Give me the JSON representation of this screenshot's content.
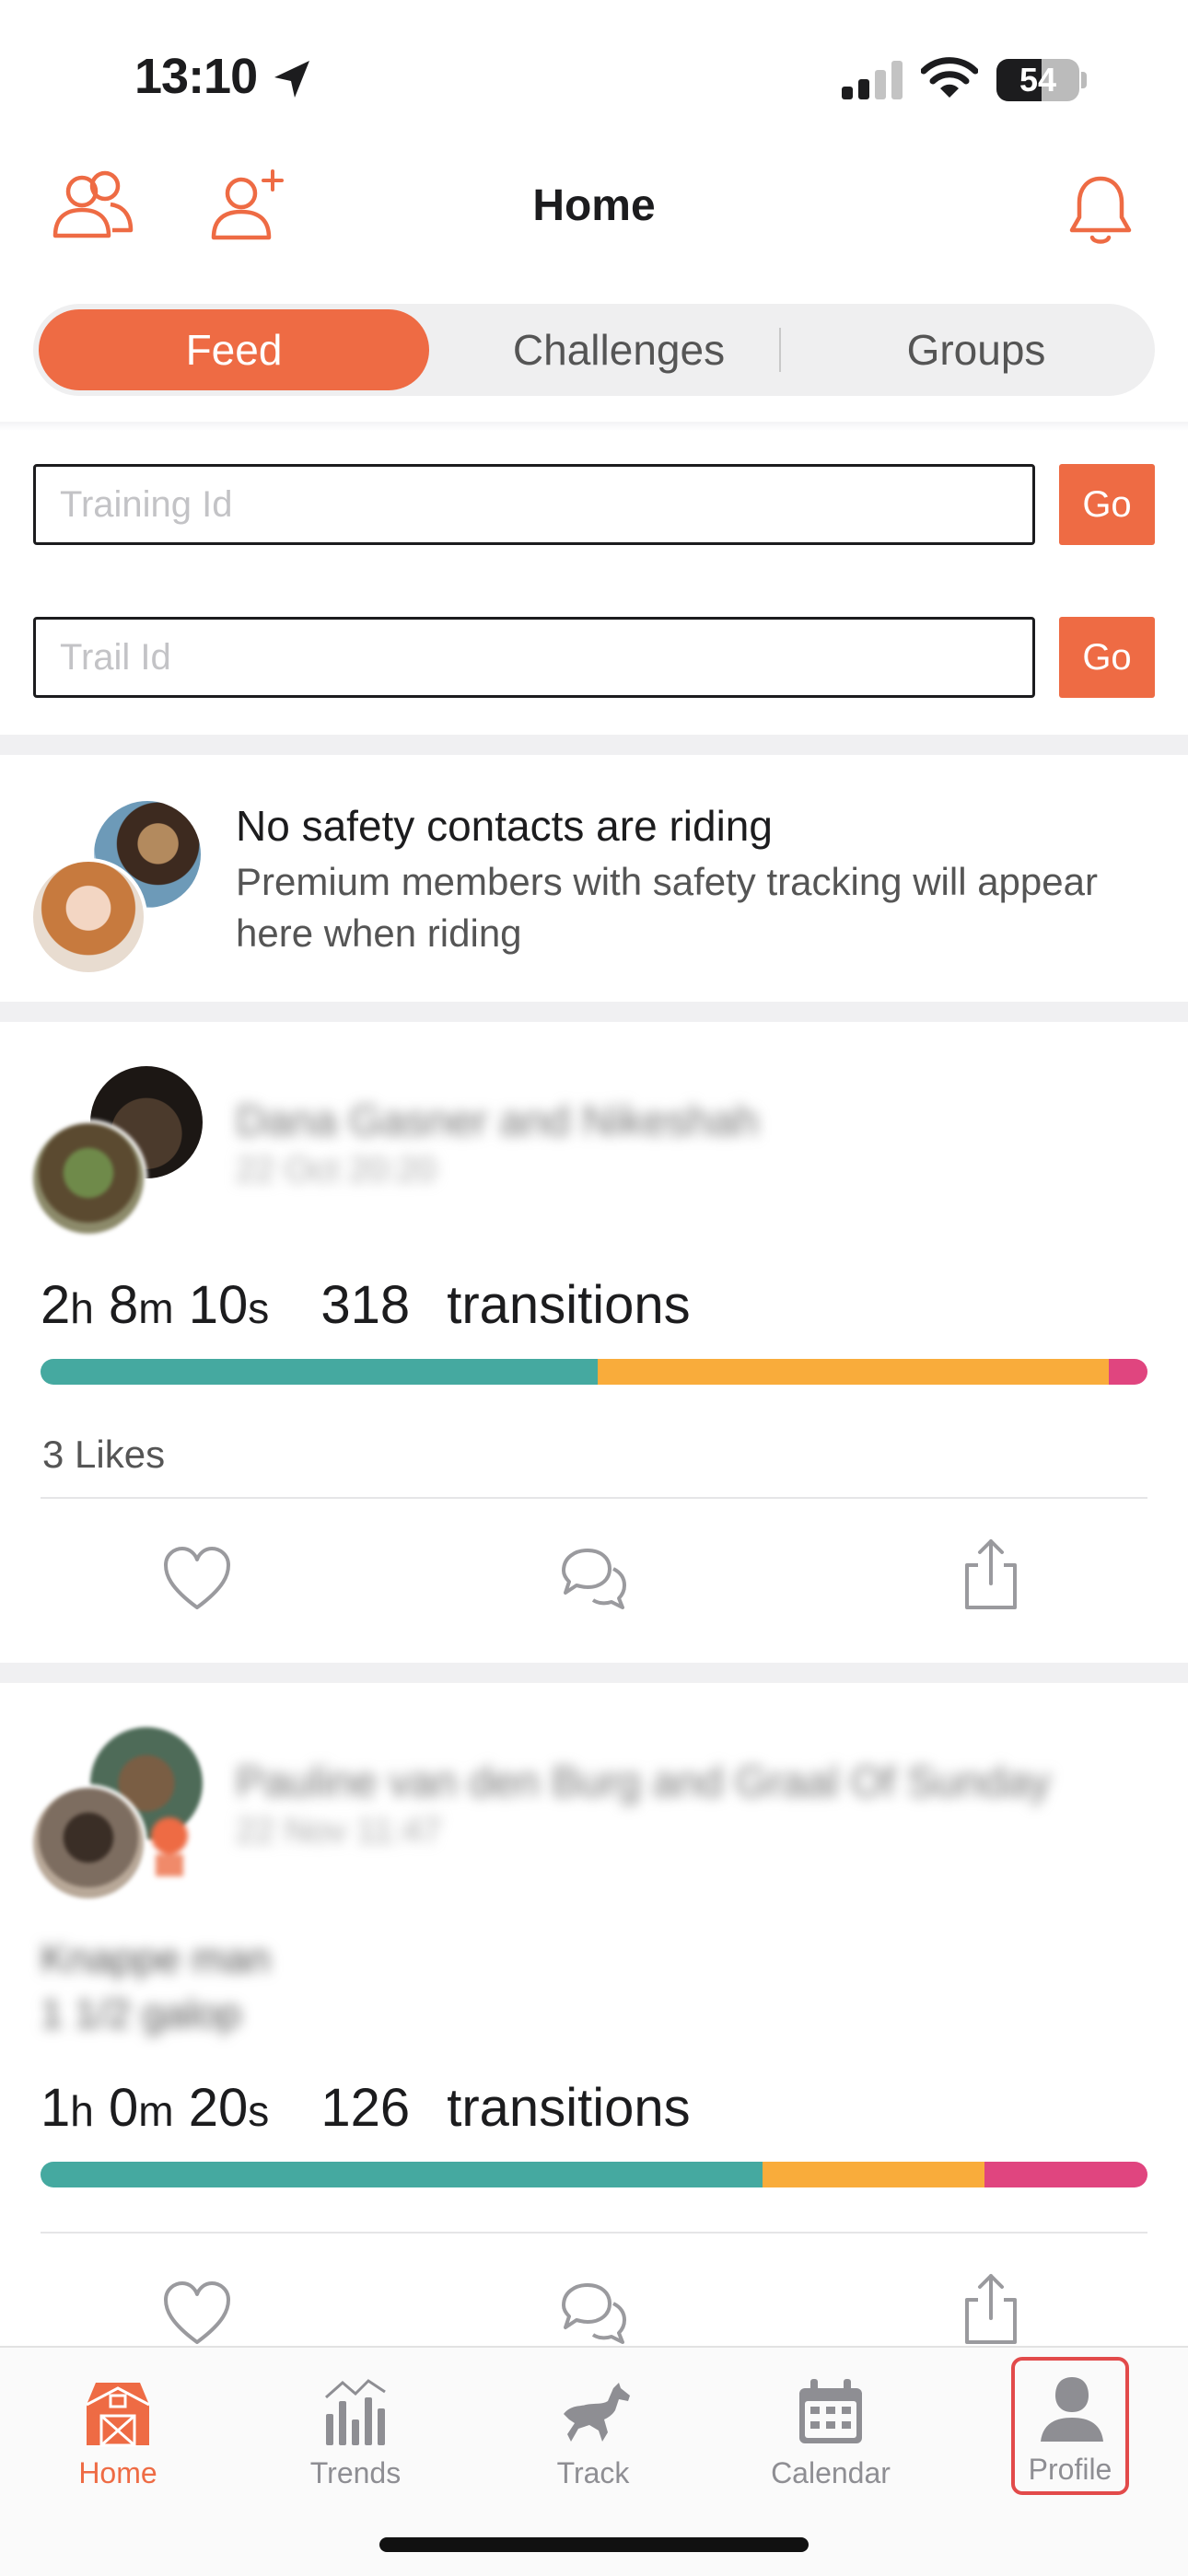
{
  "status_bar": {
    "time": "13:10",
    "battery": "54",
    "battery_level": 0.54
  },
  "header": {
    "title": "Home"
  },
  "tabs": {
    "feed": "Feed",
    "challenges": "Challenges",
    "groups": "Groups",
    "active": "Feed"
  },
  "inputs": {
    "training": {
      "placeholder": "Training Id",
      "button": "Go"
    },
    "trail": {
      "placeholder": "Trail Id",
      "button": "Go"
    }
  },
  "safety": {
    "title": "No safety contacts are riding",
    "description": "Premium members with safety tracking will appear here when riding"
  },
  "feed": [
    {
      "name": "Dana Gasner and Nikeshah",
      "date": "22 Oct 20:20",
      "duration": {
        "h": "2",
        "m": "8",
        "s": "10"
      },
      "transitions_count": "318",
      "transitions_label": "transitions",
      "gait_split": [
        0.503,
        0.462,
        0.035
      ],
      "likes": "3 Likes"
    },
    {
      "name": "Pauline van den Burg and Graal Of Sunday",
      "date": "22 Nov 11:47",
      "note_line1": "Knappe man",
      "note_line2": "1 1/2 galop",
      "duration": {
        "h": "1",
        "m": "0",
        "s": "20"
      },
      "transitions_count": "126",
      "transitions_label": "transitions",
      "gait_split": [
        0.652,
        0.201,
        0.147
      ]
    }
  ],
  "colors": {
    "accent": "#ee6b44",
    "walk": "#45a9a0",
    "trot": "#f9ac3b",
    "canter": "#e0457f"
  },
  "tabbar": {
    "home": "Home",
    "trends": "Trends",
    "track": "Track",
    "calendar": "Calendar",
    "profile": "Profile"
  },
  "unit_labels": {
    "h": "h",
    "m": "m",
    "s": "s"
  }
}
